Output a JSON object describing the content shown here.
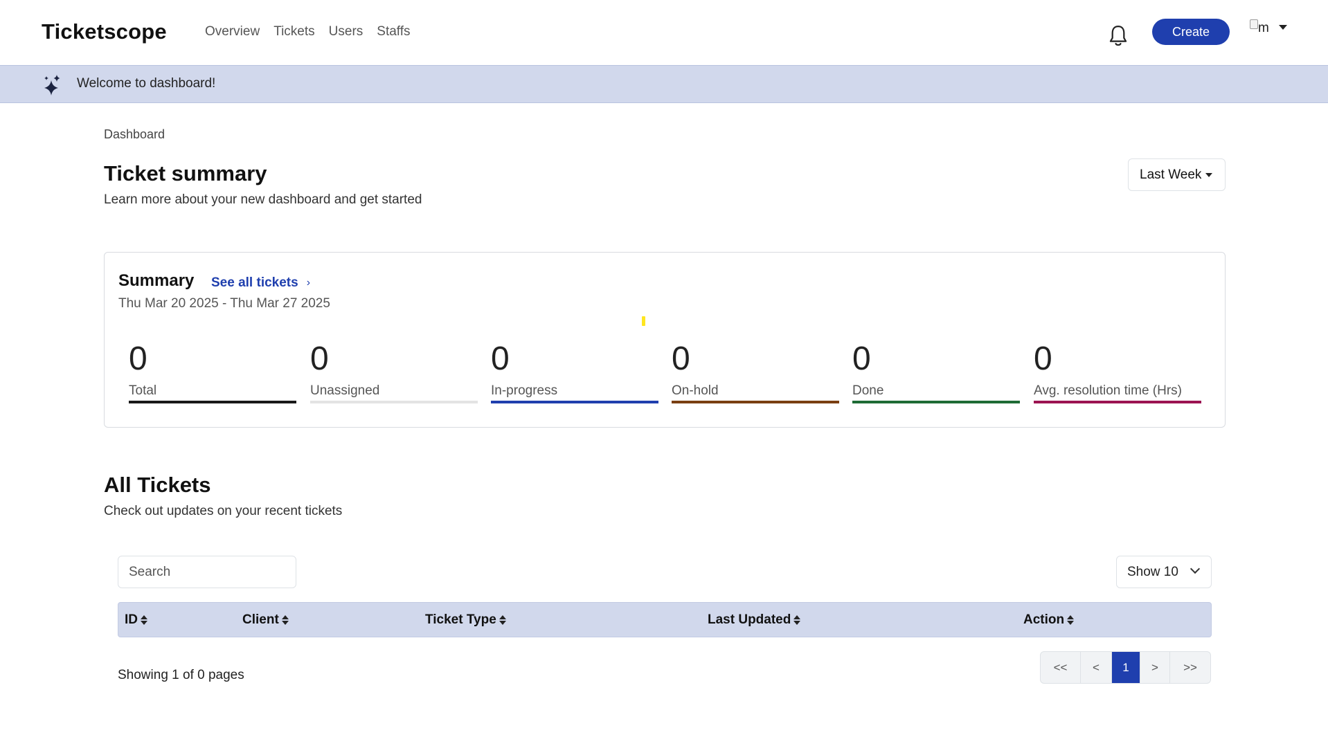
{
  "app": {
    "brand": "Ticketscope"
  },
  "nav": {
    "links": [
      "Overview",
      "Tickets",
      "Users",
      "Staffs"
    ],
    "create_label": "Create",
    "avatar_alt": "m",
    "icons": {
      "notifications": "bell-icon",
      "user_menu": "caret-down-icon"
    }
  },
  "banner": {
    "text": "Welcome to dashboard!",
    "icon": "sparkles-icon"
  },
  "header": {
    "breadcrumb": "Dashboard",
    "title": "Ticket summary",
    "subtitle": "Learn more about your new dashboard and get started",
    "range_label": "Last Week"
  },
  "summary": {
    "title": "Summary",
    "see_all_label": "See all tickets",
    "date_range": "Thu Mar 20 2025 - Thu Mar 27 2025",
    "stats": [
      {
        "value": "0",
        "label": "Total",
        "color": "#1a1a1a"
      },
      {
        "value": "0",
        "label": "Unassigned",
        "color": "#e3e3e3"
      },
      {
        "value": "0",
        "label": "In-progress",
        "color": "#1f3fae"
      },
      {
        "value": "0",
        "label": "On-hold",
        "color": "#7a3f12"
      },
      {
        "value": "0",
        "label": "Done",
        "color": "#1e6b35"
      },
      {
        "value": "0",
        "label": "Avg. resolution time (Hrs)",
        "color": "#9c1452"
      }
    ]
  },
  "tickets": {
    "title": "All Tickets",
    "subtitle": "Check out updates on your recent tickets",
    "search_placeholder": "Search",
    "page_size_label": "Show 10",
    "columns": [
      "ID",
      "Client",
      "Ticket Type",
      "Last Updated",
      "Action"
    ],
    "rows": [],
    "showing_text": "Showing 1 of 0 pages",
    "pagination": [
      "<<",
      "<",
      "1",
      ">",
      ">>"
    ],
    "current_page": "1"
  },
  "colors": {
    "accent": "#1f3fae",
    "banner_bg": "#d1d8ec"
  }
}
